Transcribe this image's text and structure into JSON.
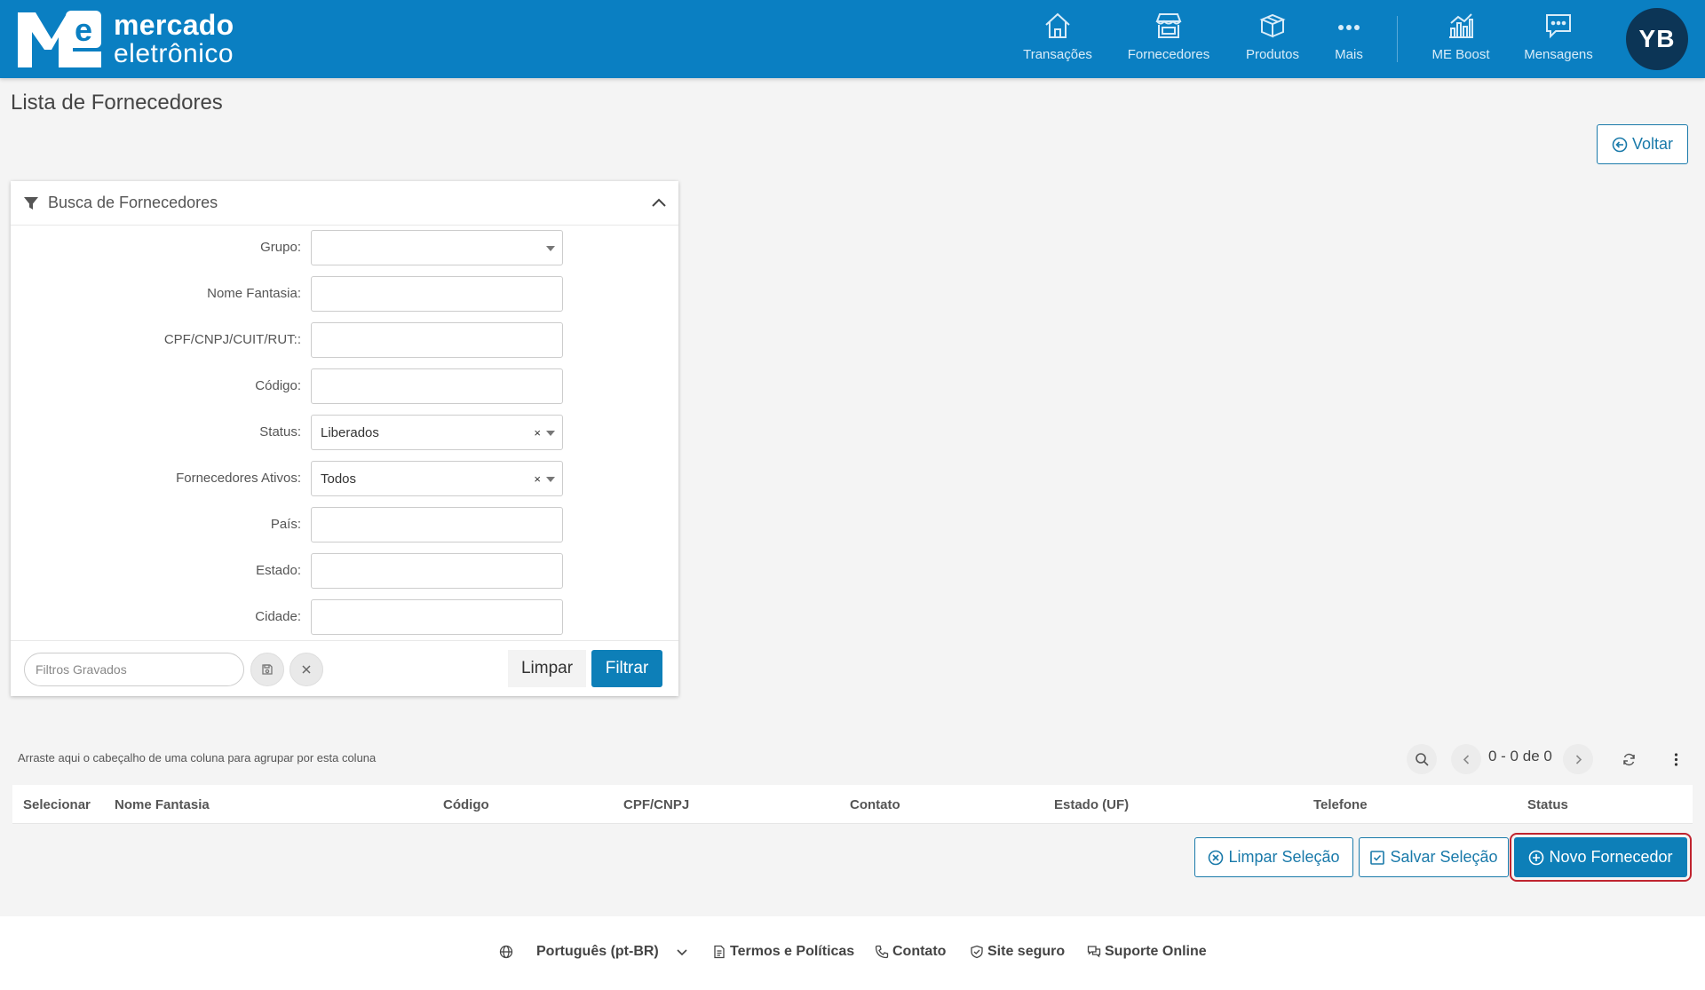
{
  "app": {
    "logo_text_line1": "mercado",
    "logo_text_line2": "eletrônico",
    "brand_color": "#0a7fc2"
  },
  "nav": {
    "items": [
      {
        "label": "Transações",
        "icon": "home-icon"
      },
      {
        "label": "Fornecedores",
        "icon": "store-icon"
      },
      {
        "label": "Produtos",
        "icon": "box-icon"
      },
      {
        "label": "Mais",
        "icon": "more-dots-icon"
      },
      {
        "label": "ME Boost",
        "icon": "chart-icon"
      },
      {
        "label": "Mensagens",
        "icon": "message-icon"
      }
    ],
    "avatar_initials": "YB"
  },
  "page": {
    "title": "Lista de Fornecedores",
    "back_button": "Voltar"
  },
  "filter_panel": {
    "title": "Busca de Fornecedores",
    "fields": [
      {
        "label": "Grupo:",
        "type": "select",
        "value": ""
      },
      {
        "label": "Nome Fantasia:",
        "type": "text",
        "value": ""
      },
      {
        "label": "CPF/CNPJ/CUIT/RUT::",
        "type": "text",
        "value": ""
      },
      {
        "label": "Código:",
        "type": "text",
        "value": ""
      },
      {
        "label": "Status:",
        "type": "select",
        "value": "Liberados"
      },
      {
        "label": "Fornecedores Ativos:",
        "type": "select",
        "value": "Todos"
      },
      {
        "label": "País:",
        "type": "text",
        "value": ""
      },
      {
        "label": "Estado:",
        "type": "text",
        "value": ""
      },
      {
        "label": "Cidade:",
        "type": "text",
        "value": ""
      }
    ],
    "clear_glyph": "×",
    "saved_filters_placeholder": "Filtros Gravados",
    "clear_button": "Limpar",
    "filter_button": "Filtrar"
  },
  "grid": {
    "group_hint": "Arraste aqui o cabeçalho de uma coluna para agrupar por esta coluna",
    "pager_text": "0 - 0 de 0",
    "columns": [
      "Selecionar",
      "Nome Fantasia",
      "Código",
      "CPF/CNPJ",
      "Contato",
      "Estado (UF)",
      "Telefone",
      "Status"
    ]
  },
  "actions": {
    "clear_selection": "Limpar Seleção",
    "save_selection": "Salvar Seleção",
    "new_supplier": "Novo Fornecedor"
  },
  "footer": {
    "language": "Português (pt-BR)",
    "terms": "Termos e Políticas",
    "contact": "Contato",
    "secure_site": "Site seguro",
    "online_support": "Suporte Online"
  }
}
